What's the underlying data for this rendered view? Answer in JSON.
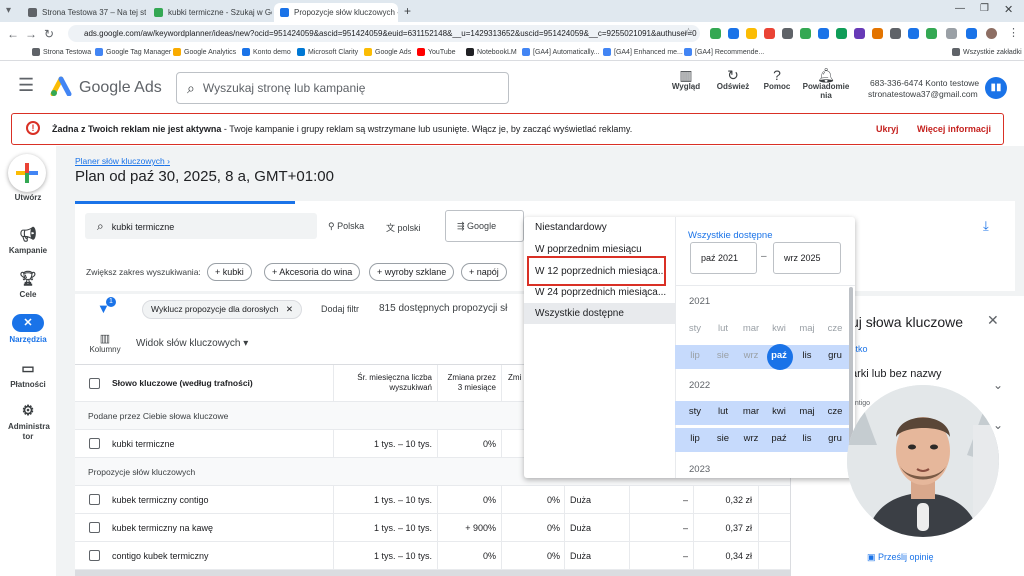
{
  "browser": {
    "tabs": [
      {
        "title": "Strona Testowa 37 – Na tej stro"
      },
      {
        "title": "kubki termiczne - Szukaj w Goo"
      },
      {
        "title": "Propozycje słów kluczowych - "
      }
    ],
    "new_tab": "+",
    "url": "ads.google.com/aw/keywordplanner/ideas/new?ocid=951424059&ascid=951424059&euid=631152148&__u=1429313652&uscid=951424059&__c=9255021091&authuser=0",
    "bookmarks": [
      "Strona Testowa",
      "Google Tag Manager",
      "Google Analytics",
      "Konto demo",
      "Microsoft Clarity",
      "Google Ads",
      "YouTube",
      "NotebookLM",
      "[GA4] Automatically...",
      "[GA4] Enhanced me...",
      "[GA4] Recommende..."
    ],
    "bookmarks_all": "Wszystkie zakładki"
  },
  "header": {
    "product": "Google Ads",
    "search_placeholder": "Wyszukaj stronę lub kampanię",
    "buttons": {
      "view": "Wygląd",
      "refresh": "Odśwież",
      "help": "Pomoc",
      "notifications": "Powiadomie nia"
    },
    "account_id": "683-336-6474 Konto testowe",
    "account_email": "stronatestowa37@gmail.com"
  },
  "alert": {
    "bold": "Żadna z Twoich reklam nie jest aktywna",
    "text": " - Twoje kampanie i grupy reklam są wstrzymane lub usunięte. Włącz je, by zacząć wyświetlać reklamy.",
    "hide": "Ukryj",
    "more": "Więcej informacji"
  },
  "nav": {
    "create": "Utwórz",
    "campaigns": "Kampanie",
    "goals": "Cele",
    "tools": "Narzędzia",
    "billing": "Płatności",
    "admin": "Administra tor"
  },
  "page": {
    "breadcrumb": "Planer słów kluczowych",
    "title": "Plan od paź 30, 2025, 8 a, GMT+01:00"
  },
  "filters": {
    "keyword": "kubki termiczne",
    "location": "Polska",
    "language": "polski",
    "network": "Google",
    "expand_label": "Zwiększ zakres wyszukiwania:",
    "chips": [
      "kubki",
      "Akcesoria do wina",
      "wyroby szklane",
      "napój"
    ],
    "exclude_adult": "Wyklucz propozycje dla dorosłych",
    "add_filter": "Dodaj filtr",
    "count": "815 dostępnych propozycji sł",
    "filter_badge": "1"
  },
  "table": {
    "columns_label": "Kolumny",
    "view_label": "Widok słów kluczowych",
    "headers": {
      "keyword": "Słowo kluczowe (według trafności)",
      "avg": "Śr. miesięczna liczba wyszukiwań",
      "change3": "Zmiana przez 3 miesiące",
      "changey": "Zmi"
    },
    "group_provided": "Podane przez Ciebie słowa kluczowe",
    "group_ideas": "Propozycje słów kluczowych",
    "rows": [
      {
        "keyword": "kubki termiczne",
        "avg": "1 tys. – 10 tys.",
        "change3": "0%",
        "changey": "",
        "competition": "",
        "share": "",
        "bid": ""
      },
      {
        "keyword": "kubek termiczny contigo",
        "avg": "1 tys. – 10 tys.",
        "change3": "0%",
        "changey": "0%",
        "competition": "Duża",
        "share": "–",
        "bid": "0,32 zł"
      },
      {
        "keyword": "kubek termiczny na kawę",
        "avg": "1 tys. – 10 tys.",
        "change3": "+ 900%",
        "changey": "0%",
        "competition": "Duża",
        "share": "–",
        "bid": "0,37 zł"
      },
      {
        "keyword": "contigo kubek termiczny",
        "avg": "1 tys. – 10 tys.",
        "change3": "0%",
        "changey": "0%",
        "competition": "Duża",
        "share": "–",
        "bid": "0,34 zł"
      }
    ]
  },
  "date_dropdown": {
    "options": [
      "Niestandardowy",
      "W poprzednim miesiącu",
      "W 12 poprzednich miesiąca...",
      "W 24 poprzednich miesiąca...",
      "Wszystkie dostępne"
    ],
    "selected_index": 4,
    "highlighted_index": 2,
    "range_title": "Wszystkie dostępne",
    "from": "paź 2021",
    "to": "wrz 2025",
    "dash": "–",
    "years": [
      "2021",
      "2022",
      "2023"
    ],
    "months": [
      "sty",
      "lut",
      "mar",
      "kwi",
      "maj",
      "cze",
      "lip",
      "sie",
      "wrz",
      "paź",
      "lis",
      "gru"
    ],
    "selected_month": "paź"
  },
  "right_panel": {
    "title": "uj słowa kluczowe",
    "link": "stko",
    "item1": "arki lub bez nazwy",
    "item2": "ontigo",
    "feedback": "Prześlij opinię"
  },
  "colors": {
    "accent": "#1a73e8",
    "alert_red": "#d93025",
    "highlight_box": "#d93025",
    "range_band": "#c6dafc"
  }
}
